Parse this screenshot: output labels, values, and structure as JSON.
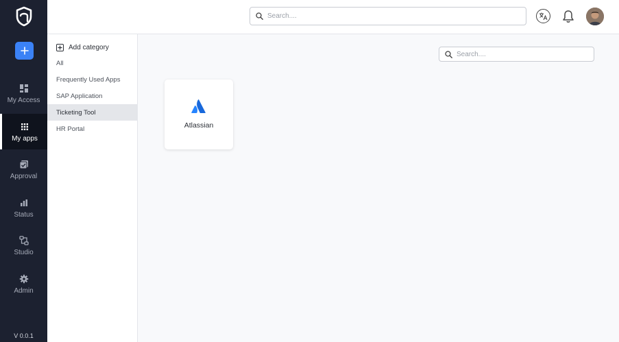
{
  "sidebar": {
    "items": [
      {
        "label": "My Access",
        "icon": "dashboard-icon"
      },
      {
        "label": "My apps",
        "icon": "grid-icon",
        "active": true
      },
      {
        "label": "Approval",
        "icon": "approval-icon"
      },
      {
        "label": "Status",
        "icon": "bar-chart-icon"
      },
      {
        "label": "Studio",
        "icon": "studio-icon"
      },
      {
        "label": "Admin",
        "icon": "gear-icon"
      }
    ],
    "version": "V 0.0.1"
  },
  "header": {
    "search_placeholder": "Search...."
  },
  "categories": {
    "add_label": "Add category",
    "items": [
      "All",
      "Frequently Used Apps",
      "SAP Application",
      "Ticketing Tool",
      "HR Portal"
    ],
    "selected": "Ticketing Tool"
  },
  "main": {
    "search_placeholder": "Search....",
    "apps": [
      {
        "name": "Atlassian",
        "icon": "atlassian-icon",
        "color": "#2684ff"
      }
    ]
  },
  "colors": {
    "rail_bg": "#1c2130",
    "accent": "#3b82f6",
    "selected_bg": "#e4e6ea"
  }
}
